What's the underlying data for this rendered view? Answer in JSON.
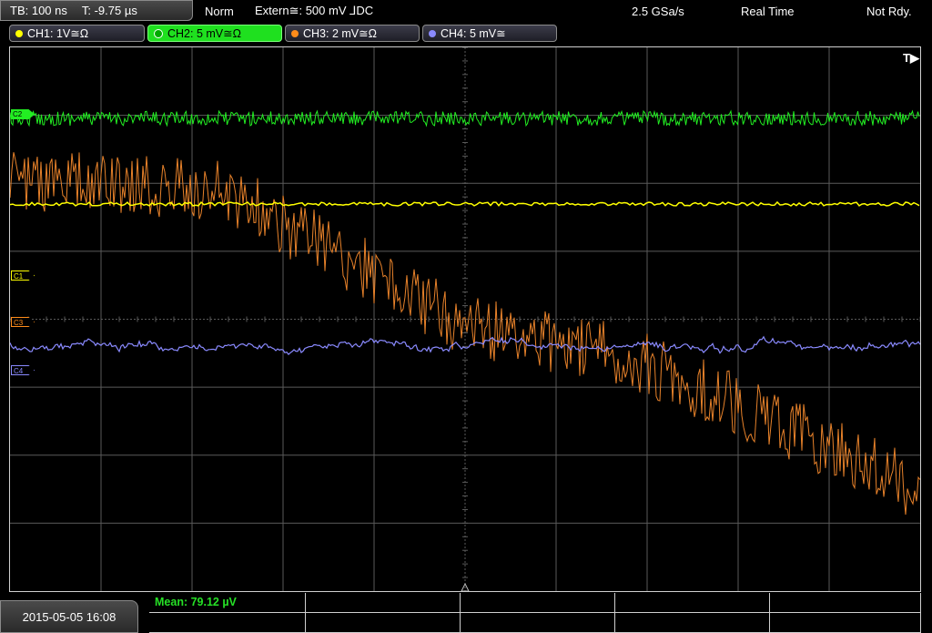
{
  "header": {
    "timebase": "TB: 100 ns",
    "trigger_time": "T: -9.75 µs",
    "trigger_mode": "Norm",
    "trigger_source": "Extern≅: 500 mV ⅃DC",
    "sample_rate": "2.5 GSa/s",
    "acq_mode": "Real Time",
    "status": "Not Rdy."
  },
  "channels": [
    {
      "label": "CH1: 1V≅Ω",
      "color": "#ffff00"
    },
    {
      "label": "CH2: 5 mV≅Ω",
      "color": "#22ee22",
      "active": true
    },
    {
      "label": "CH3: 2 mV≅Ω",
      "color": "#ff8c1a"
    },
    {
      "label": "CH4: 5 mV≅",
      "color": "#8a8aff"
    }
  ],
  "markers": {
    "c1": "C1",
    "c2": "C2",
    "c3": "C3",
    "c4": "C4"
  },
  "trigger_flag": "T▶",
  "footer": {
    "datetime": "2015-05-05 16:08",
    "measurement": "Mean: 79.12 µV"
  },
  "colors": {
    "ch1": "#ffff00",
    "ch2": "#22ee22",
    "ch3": "#e8822a",
    "ch4": "#8a8aff",
    "grid": "#5a5a5a"
  }
}
